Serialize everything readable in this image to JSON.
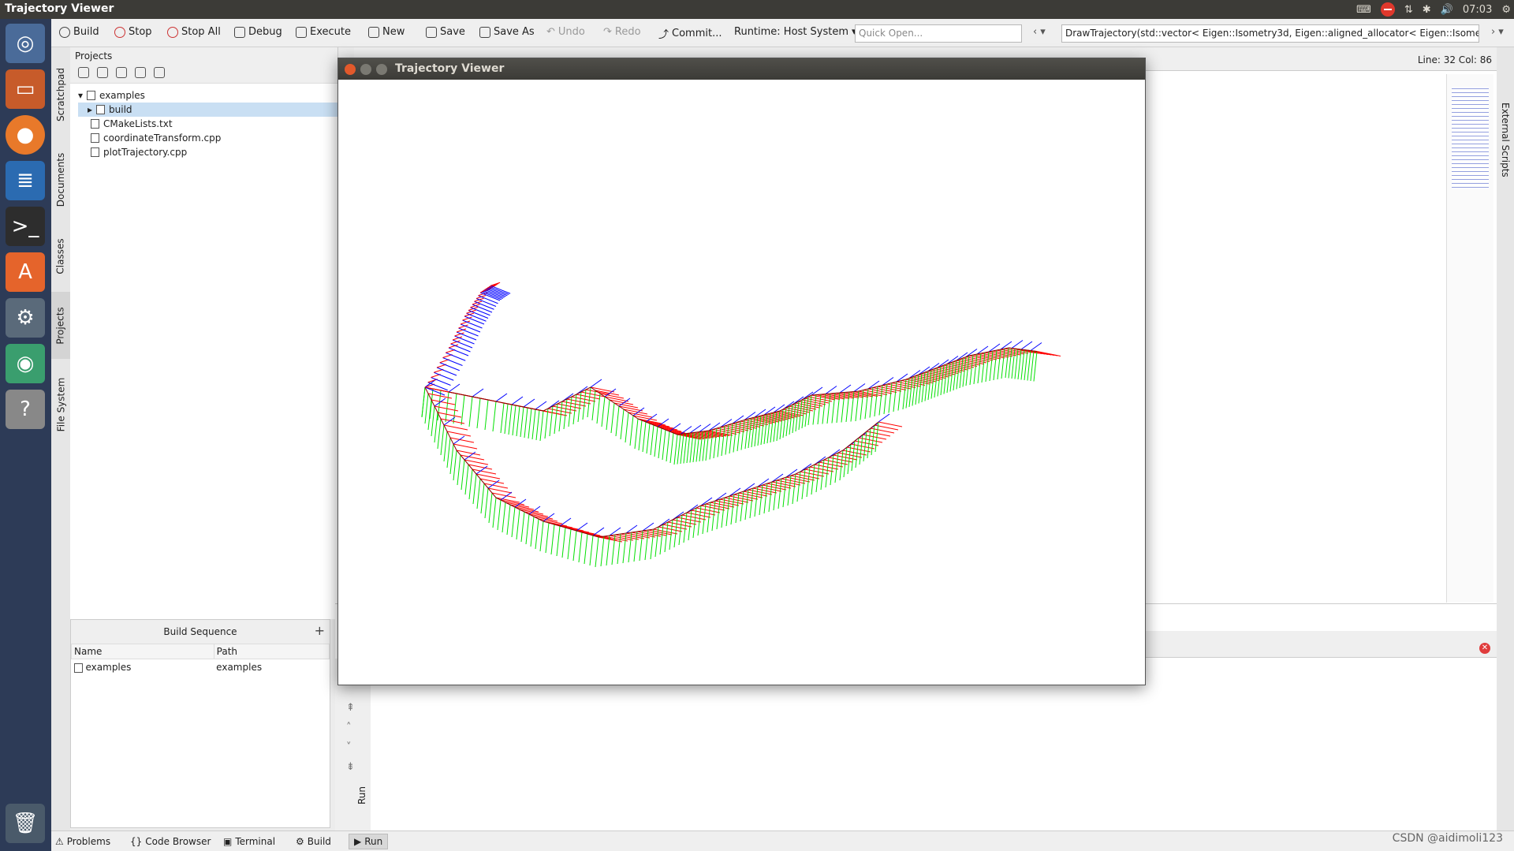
{
  "topbar": {
    "title": "Trajectory Viewer",
    "clock": "07:03"
  },
  "toolbar": {
    "build": "Build",
    "stop": "Stop",
    "stop_all": "Stop All",
    "debug": "Debug",
    "execute": "Execute",
    "new": "New",
    "save": "Save",
    "save_as": "Save As",
    "undo": "Undo",
    "redo": "Redo",
    "commit": "Commit...",
    "runtime": "Runtime: Host System",
    "quick_open_placeholder": "Quick Open...",
    "function_combo": "DrawTrajectory(std::vector< Eigen::Isometry3d, Eigen::aligned_allocator< Eigen::Isometry3d >"
  },
  "left_tabs": [
    "Scratchpad",
    "Documents",
    "Classes",
    "Projects",
    "File System"
  ],
  "projects": {
    "header": "Projects",
    "tree": [
      {
        "label": "examples"
      },
      {
        "label": "build"
      },
      {
        "label": "CMakeLists.txt"
      },
      {
        "label": "coordinateTransform.cpp"
      },
      {
        "label": "plotTrajectory.cpp"
      }
    ]
  },
  "build_sequence": {
    "title": "Build Sequence",
    "add": "+",
    "columns": [
      "Name",
      "Path"
    ],
    "rows": [
      {
        "name": "examples",
        "path": "examples"
      }
    ]
  },
  "editor": {
    "line_info": "Line: 32 Col: 86"
  },
  "right_strip": "External Scripts",
  "output": {
    "run_label": "Run"
  },
  "bottom_tabs": [
    "Problems",
    "Code Browser",
    "Terminal",
    "Build",
    "Run"
  ],
  "watermark": "CSDN @aidimoli123",
  "viewer": {
    "title": "Trajectory Viewer"
  },
  "colors": {
    "x_axis": "#ff0000",
    "y_axis": "#00e000",
    "z_axis": "#0000ff",
    "trajectory": "#8b0000"
  }
}
